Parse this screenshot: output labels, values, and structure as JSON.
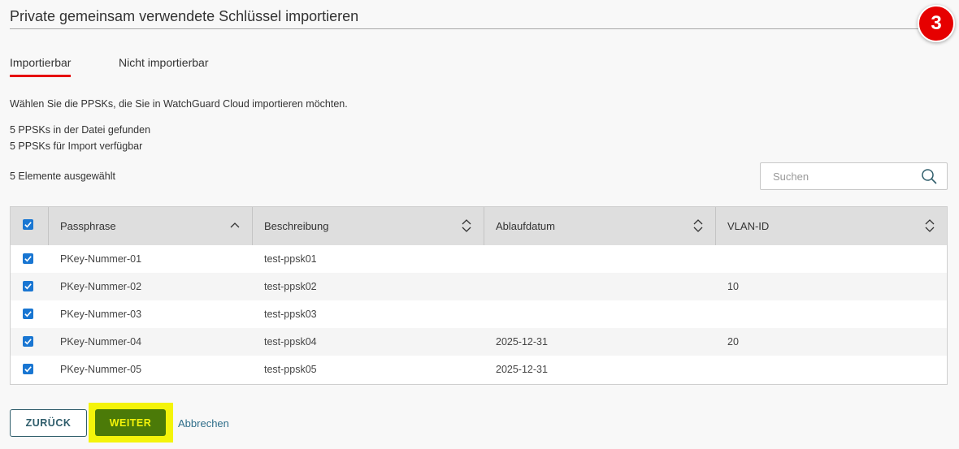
{
  "header": {
    "title": "Private gemeinsam verwendete Schlüssel importieren",
    "step_badge": "3",
    "badge_color": "#e60000"
  },
  "tabs": [
    {
      "label": "Importierbar",
      "active": true
    },
    {
      "label": "Nicht importierbar",
      "active": false
    }
  ],
  "info": {
    "instruction": "Wählen Sie die PPSKs, die Sie in WatchGuard Cloud importieren möchten.",
    "found": "5 PPSKs in der Datei gefunden",
    "available": "5 PPSKs für Import verfügbar",
    "selected": "5 Elemente ausgewählt"
  },
  "search": {
    "placeholder": "Suchen",
    "value": "",
    "icon": "search-icon"
  },
  "table": {
    "columns": [
      "Passphrase",
      "Beschreibung",
      "Ablaufdatum",
      "VLAN-ID"
    ],
    "rows": [
      {
        "checked": true,
        "passphrase": "PKey-Nummer-01",
        "description": "test-ppsk01",
        "expiry": "",
        "vlan": ""
      },
      {
        "checked": true,
        "passphrase": "PKey-Nummer-02",
        "description": "test-ppsk02",
        "expiry": "",
        "vlan": "10"
      },
      {
        "checked": true,
        "passphrase": "PKey-Nummer-03",
        "description": "test-ppsk03",
        "expiry": "",
        "vlan": ""
      },
      {
        "checked": true,
        "passphrase": "PKey-Nummer-04",
        "description": "test-ppsk04",
        "expiry": "2025-12-31",
        "vlan": "20"
      },
      {
        "checked": true,
        "passphrase": "PKey-Nummer-05",
        "description": "test-ppsk05",
        "expiry": "2025-12-31",
        "vlan": ""
      }
    ]
  },
  "footer": {
    "back_label": "ZURÜCK",
    "next_label": "WEITER",
    "cancel_label": "Abbrechen"
  },
  "colors": {
    "accent_red": "#e60000",
    "next_button": "#4b7a08",
    "next_text": "#f4f40a",
    "checkbox": "#1976d2",
    "link": "#2f6e8a"
  }
}
